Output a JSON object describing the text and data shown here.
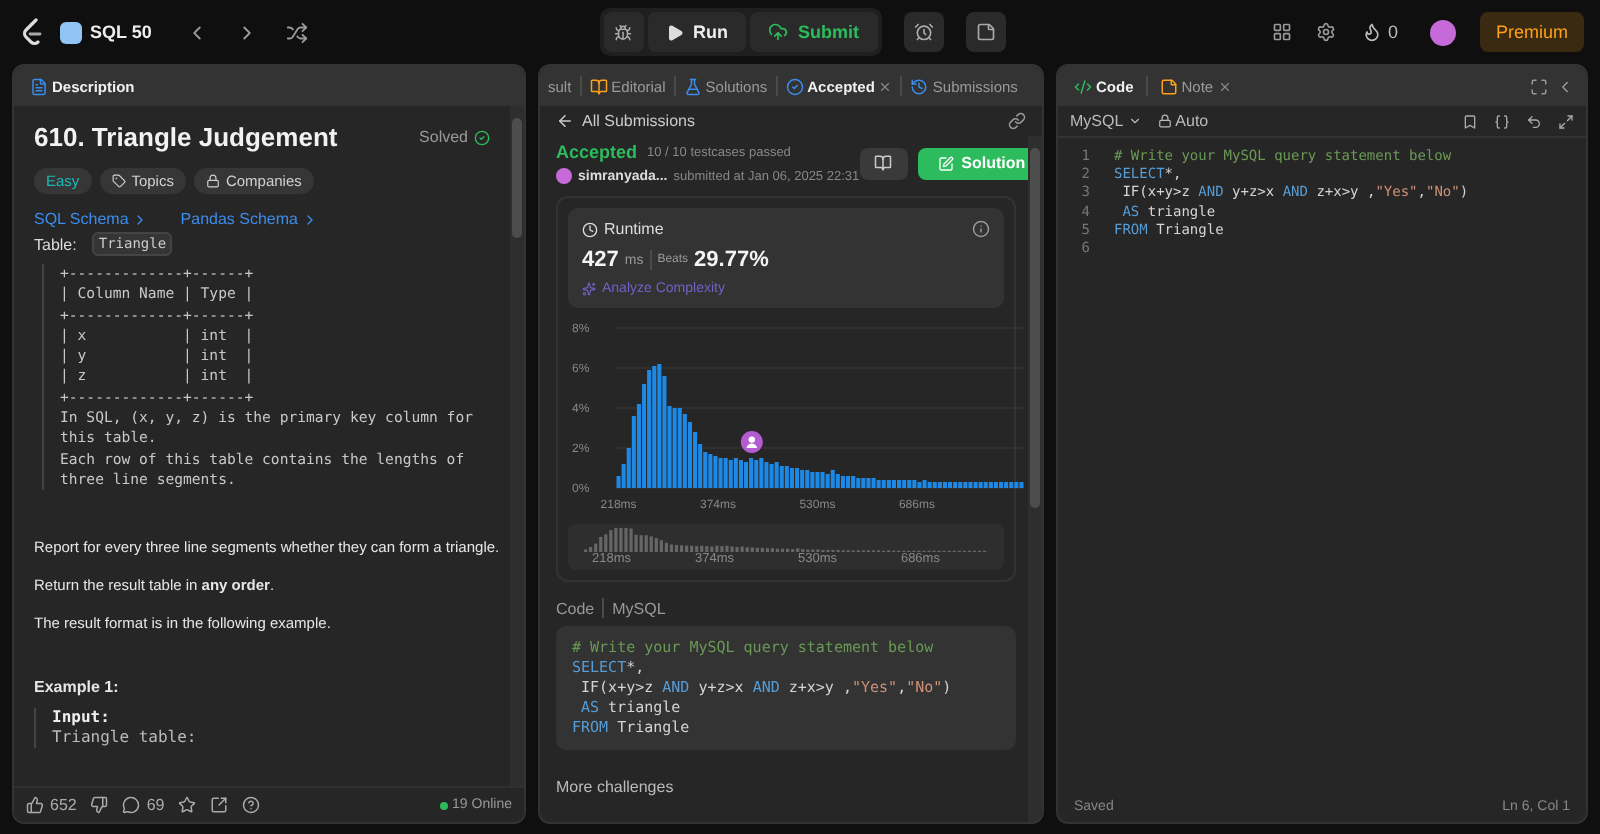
{
  "nav": {
    "list_title": "SQL 50",
    "run": "Run",
    "submit": "Submit",
    "streak": "0",
    "premium": "Premium"
  },
  "description": {
    "tab": "Description",
    "title": "610. Triangle Judgement",
    "status": "Solved",
    "tags": [
      {
        "kind": "difficulty",
        "label": "Easy"
      },
      {
        "kind": "topics",
        "label": "Topics"
      },
      {
        "kind": "companies",
        "label": "Companies"
      }
    ],
    "schema_links": [
      "SQL Schema",
      "Pandas Schema"
    ],
    "table_label": "Table:",
    "table_name": "Triangle",
    "schema_table": [
      "+-------------+------+",
      "| Column Name | Type |",
      "+-------------+------+",
      "| x           | int  |",
      "| y           | int  |",
      "| z           | int  |",
      "+-------------+------+"
    ],
    "schema_notes": [
      "In SQL, (x, y, z) is the primary key column for",
      "this table.",
      "Each row of this table contains the lengths of",
      "three line segments."
    ],
    "paragraphs": [
      "Report for every three line segments whether they can form a triangle.",
      "Return the result table in **any order**.",
      "The result format is in the following example."
    ],
    "example_heading": "Example 1:",
    "example_input": "Input:",
    "example_table": "Triangle table:",
    "footer": {
      "likes": "652",
      "comments": "69",
      "online": "19 Online"
    }
  },
  "submission": {
    "tabs": [
      {
        "kind": "result",
        "label": "sult",
        "selected": false
      },
      {
        "kind": "editorial",
        "label": "Editorial",
        "selected": false
      },
      {
        "kind": "solutions",
        "label": "Solutions",
        "selected": false
      },
      {
        "kind": "accepted",
        "label": "Accepted",
        "selected": true,
        "closable": true
      },
      {
        "kind": "submissions",
        "label": "Submissions",
        "selected": false
      }
    ],
    "back": "All Submissions",
    "verdict": "Accepted",
    "testcases": "10 / 10 testcases passed",
    "user": "simranyada...",
    "submitted": "submitted at Jan 06, 2025 22:31",
    "solution_button": "Solution",
    "runtime": {
      "title": "Runtime",
      "value": "427",
      "unit": "ms",
      "beats_label": "Beats",
      "beats": "29.77%",
      "analyze": "Analyze Complexity",
      "chart_data": {
        "type": "bar",
        "xlim": [
          214,
          854
        ],
        "ylim": [
          0,
          8
        ],
        "x": [
          218,
          226,
          234,
          242,
          250,
          258,
          266,
          274,
          282,
          290,
          298,
          306,
          314,
          322,
          330,
          338,
          346,
          354,
          362,
          370,
          378,
          386,
          394,
          402,
          410,
          418,
          426,
          434,
          442,
          450,
          458,
          466,
          474,
          482,
          490,
          498,
          506,
          514,
          522,
          530,
          538,
          546,
          554,
          562,
          570,
          578,
          586,
          594,
          602,
          610,
          618,
          626,
          634,
          642,
          650,
          658,
          666,
          674,
          682,
          690,
          698,
          706,
          714,
          722,
          730,
          738,
          746,
          754,
          762,
          770,
          778,
          786,
          794,
          802,
          810,
          818,
          826,
          834,
          842,
          850
        ],
        "series": [
          {
            "color": "#1e88e5",
            "values": [
              0.6,
              1.2,
              2.0,
              3.6,
              4.2,
              5.2,
              5.9,
              6.1,
              6.2,
              5.6,
              4.1,
              4.0,
              4.0,
              3.7,
              3.3,
              2.8,
              2.2,
              1.8,
              1.7,
              1.6,
              1.5,
              1.5,
              1.4,
              1.5,
              1.4,
              1.3,
              1.5,
              1.4,
              1.5,
              1.3,
              1.2,
              1.3,
              1.1,
              1.1,
              1.0,
              1.0,
              0.9,
              0.9,
              0.8,
              0.8,
              0.8,
              0.7,
              0.9,
              0.7,
              0.6,
              0.6,
              0.6,
              0.5,
              0.5,
              0.5,
              0.5,
              0.4,
              0.4,
              0.4,
              0.4,
              0.4,
              0.4,
              0.4,
              0.4,
              0.3,
              0.4,
              0.3,
              0.3,
              0.3,
              0.3,
              0.3,
              0.3,
              0.3,
              0.3,
              0.3,
              0.3,
              0.3,
              0.3,
              0.3,
              0.3,
              0.3,
              0.3,
              0.3,
              0.3,
              0.3
            ]
          }
        ],
        "yticks": [
          {
            "value": 0,
            "label": "0%"
          },
          {
            "value": 2,
            "label": "2%"
          },
          {
            "value": 4,
            "label": "4%"
          },
          {
            "value": 6,
            "label": "6%"
          },
          {
            "value": 8,
            "label": "8%"
          }
        ],
        "xticks": [
          {
            "value": 218,
            "label": "218ms"
          },
          {
            "value": 374,
            "label": "374ms"
          },
          {
            "value": 530,
            "label": "530ms"
          },
          {
            "value": 686,
            "label": "686ms"
          }
        ],
        "grid": true
      },
      "navigator_labels": [
        "218ms",
        "374ms",
        "530ms",
        "686ms"
      ]
    },
    "code_label": "Code",
    "code_language": "MySQL",
    "code_lines": [
      [
        {
          "kind": "comment",
          "text": "# Write your MySQL query statement below"
        }
      ],
      [
        {
          "kind": "keyword",
          "text": "SELECT"
        },
        {
          "kind": "plain",
          "text": "*,"
        }
      ],
      [
        {
          "kind": "plain",
          "text": " IF(x+y>z "
        },
        {
          "kind": "keyword",
          "text": "AND"
        },
        {
          "kind": "plain",
          "text": " y+z>x "
        },
        {
          "kind": "keyword",
          "text": "AND"
        },
        {
          "kind": "plain",
          "text": " z+x>y ,"
        },
        {
          "kind": "string",
          "text": "\"Yes\""
        },
        {
          "kind": "plain",
          "text": ","
        },
        {
          "kind": "string",
          "text": "\"No\""
        },
        {
          "kind": "plain",
          "text": ")"
        }
      ],
      [
        {
          "kind": "keyword",
          "text": "AS",
          "indent": true
        },
        {
          "kind": "plain",
          "text": " triangle"
        }
      ],
      [
        {
          "kind": "keyword",
          "text": "FROM"
        },
        {
          "kind": "plain",
          "text": " Triangle"
        }
      ]
    ],
    "more": "More challenges"
  },
  "editor": {
    "tabs": [
      {
        "kind": "code",
        "label": "Code",
        "selected": true,
        "closable": false
      },
      {
        "kind": "note",
        "label": "Note",
        "selected": false,
        "closable": true
      }
    ],
    "language": "MySQL",
    "mode": "Auto",
    "lines": [
      {
        "number": "1",
        "tokens": [
          {
            "kind": "comment",
            "text": "# Write your MySQL query statement below"
          }
        ]
      },
      {
        "number": "2",
        "tokens": [
          {
            "kind": "keyword",
            "text": "SELECT"
          },
          {
            "kind": "plain",
            "text": "*,"
          }
        ]
      },
      {
        "number": "3",
        "tokens": [
          {
            "kind": "plain",
            "text": " IF(x+y>z "
          },
          {
            "kind": "keyword",
            "text": "AND"
          },
          {
            "kind": "plain",
            "text": " y+z>x "
          },
          {
            "kind": "keyword",
            "text": "AND"
          },
          {
            "kind": "plain",
            "text": " z+x>y ,"
          },
          {
            "kind": "string",
            "text": "\"Yes\""
          },
          {
            "kind": "plain",
            "text": ","
          },
          {
            "kind": "string",
            "text": "\"No\""
          },
          {
            "kind": "plain",
            "text": ")"
          }
        ]
      },
      {
        "number": "4",
        "tokens": [
          {
            "kind": "keyword",
            "text": "AS",
            "indent": true
          },
          {
            "kind": "plain",
            "text": " triangle"
          }
        ]
      },
      {
        "number": "5",
        "tokens": [
          {
            "kind": "keyword",
            "text": "FROM"
          },
          {
            "kind": "plain",
            "text": " Triangle"
          }
        ]
      },
      {
        "number": "6"
      }
    ],
    "status_left": "Saved",
    "status_right": "Ln 6, Col 1"
  }
}
